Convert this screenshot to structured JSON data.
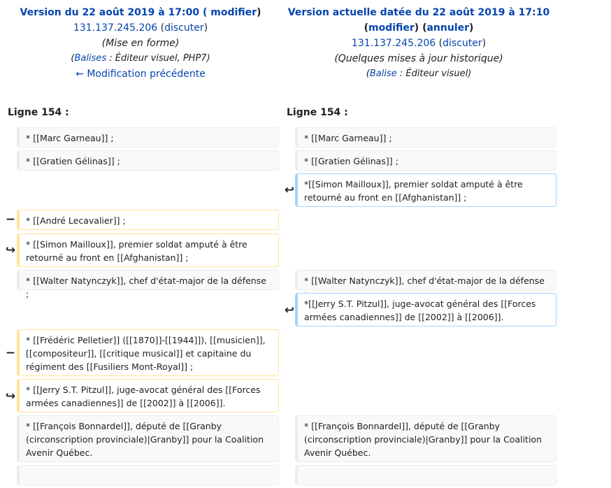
{
  "left_header": {
    "title_prefix": "Version du 22 août 2019 à 17:00 (",
    "modify_link": "modifier",
    "title_suffix": ")",
    "user_ip": "131.137.245.206",
    "talk_open": " (",
    "talk_link": "discuter",
    "talk_close": ")",
    "summary": "(Mise en forme)",
    "tags_open": "(",
    "tags_link": "Balises",
    "tags_sep": " : ",
    "tags_values": "Éditeur visuel, PHP7",
    "tags_close": ")",
    "prev_link": "← Modification précédente"
  },
  "right_header": {
    "title": "Version actuelle datée du 22 août 2019 à 17:10",
    "modify_open": "(",
    "modify_link": "modifier",
    "modify_close": ") (",
    "undo_link": "annuler",
    "undo_close": ")",
    "user_ip": "131.137.245.206",
    "talk_open": " (",
    "talk_link": "discuter",
    "talk_close": ")",
    "summary": "(Quelques mises à jour historique)",
    "tag_open": "(",
    "tag_link": "Balise",
    "tag_sep": " : ",
    "tag_values": "Éditeur visuel",
    "tag_close": ")"
  },
  "line_labels": {
    "left": "Ligne 154 :",
    "right": "Ligne 154 :"
  },
  "markers": {
    "removed": "−",
    "moved": "↪",
    "moved_right": "↩"
  },
  "diff": {
    "l_ctx1": "* [[Marc Garneau]] ;",
    "r_ctx1": "* [[Marc Garneau]] ;",
    "l_ctx2": "* [[Gratien Gélinas]] ;",
    "r_ctx2": "* [[Gratien Gélinas]] ;",
    "r_add1_star": "*",
    "r_add1_rest": "[[Simon Mailloux]], premier soldat amputé à être retourné au front en [[Afghanistan]] ;",
    "l_del1": "* [[André Lecavalier]] ;",
    "l_mov1_star": "* ",
    "l_mov1_rest": "[[Simon Mailloux]], premier soldat amputé à être retourné au front en [[Afghanistan]] ;",
    "l_ctx3": "* [[Walter Natynczyk]], chef d'état-major de la défense ;",
    "r_ctx3": "* [[Walter Natynczyk]], chef d'état-major de la défense ;",
    "r_add2_star": "*",
    "r_add2_rest": "[[Jerry S.T. Pitzul]], juge-avocat général des [[Forces armées canadiennes]] de [[2002]] à [[2006]].",
    "l_del2": "* [[Frédéric Pelletier]] ([[1870]]-[[1944]]), [[musicien]], [[compositeur]], [[critique musical]] et capitaine du régiment des [[Fusiliers Mont-Royal]] ;",
    "l_mov2_star": "* ",
    "l_mov2_rest": "[[Jerry S.T. Pitzul]], juge-avocat général des [[Forces armées canadiennes]] de [[2002]] à [[2006]].",
    "l_ctx4": "* [[François Bonnardel]], député de [[Granby (circonscription provinciale)|Granby]] pour la Coalition Avenir Québec.",
    "r_ctx4": "* [[François Bonnardel]], député de [[Granby (circonscription provinciale)|Granby]] pour la Coalition Avenir Québec."
  }
}
